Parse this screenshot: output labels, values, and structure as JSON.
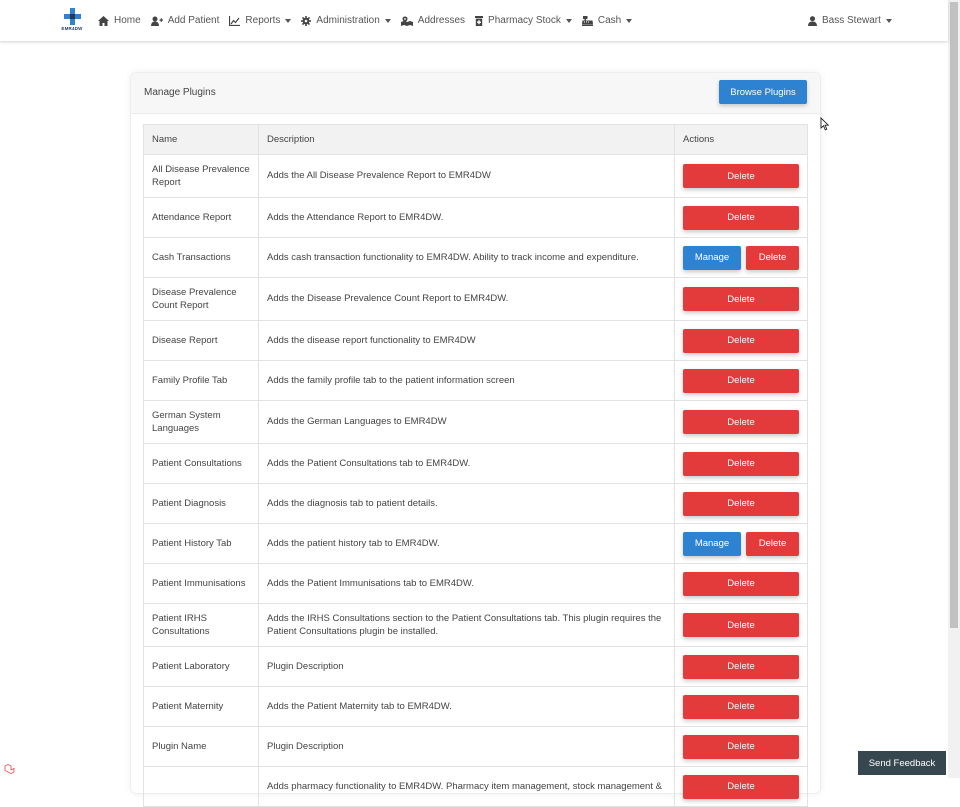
{
  "brand": {
    "name": "EMR4DW",
    "accent": "#2d82d2"
  },
  "nav": {
    "items": [
      {
        "label": "Home",
        "icon": "home-icon",
        "dropdown": false
      },
      {
        "label": "Add Patient",
        "icon": "user-plus-icon",
        "dropdown": false
      },
      {
        "label": "Reports",
        "icon": "chart-icon",
        "dropdown": true
      },
      {
        "label": "Administration",
        "icon": "gear-icon",
        "dropdown": true
      },
      {
        "label": "Addresses",
        "icon": "map-icon",
        "dropdown": false
      },
      {
        "label": "Pharmacy Stock",
        "icon": "medicine-bottle-icon",
        "dropdown": true
      },
      {
        "label": "Cash",
        "icon": "cash-register-icon",
        "dropdown": true
      }
    ],
    "user": {
      "name": "Bass Stewart",
      "icon": "user-icon"
    }
  },
  "card": {
    "title": "Manage Plugins",
    "browse_label": "Browse Plugins"
  },
  "table": {
    "headers": [
      "Name",
      "Description",
      "Actions"
    ],
    "rows": [
      {
        "name": "All Disease Prevalence Report",
        "description": "Adds the All Disease Prevalence Report to EMR4DW",
        "manage": false
      },
      {
        "name": "Attendance Report",
        "description": "Adds the Attendance Report to EMR4DW.",
        "manage": false
      },
      {
        "name": "Cash Transactions",
        "description": "Adds cash transaction functionality to EMR4DW. Ability to track income and expenditure.",
        "manage": true
      },
      {
        "name": "Disease Prevalence Count Report",
        "description": "Adds the Disease Prevalence Count Report to EMR4DW.",
        "manage": false
      },
      {
        "name": "Disease Report",
        "description": "Adds the disease report functionality to EMR4DW",
        "manage": false
      },
      {
        "name": "Family Profile Tab",
        "description": "Adds the family profile tab to the patient information screen",
        "manage": false
      },
      {
        "name": "German System Languages",
        "description": "Adds the German Languages to EMR4DW",
        "manage": false
      },
      {
        "name": "Patient Consultations",
        "description": "Adds the Patient Consultations tab to EMR4DW.",
        "manage": false
      },
      {
        "name": "Patient Diagnosis",
        "description": "Adds the diagnosis tab to patient details.",
        "manage": false
      },
      {
        "name": "Patient History Tab",
        "description": "Adds the patient history tab to EMR4DW.",
        "manage": true
      },
      {
        "name": "Patient Immunisations",
        "description": "Adds the Patient Immunisations tab to EMR4DW.",
        "manage": false
      },
      {
        "name": "Patient IRHS Consultations",
        "description": "Adds the IRHS Consultations section to the Patient Consultations tab. This plugin requires the Patient Consultations plugin be installed.",
        "manage": false
      },
      {
        "name": "Patient Laboratory",
        "description": "Plugin Description",
        "manage": false
      },
      {
        "name": "Patient Maternity",
        "description": "Adds the Patient Maternity tab to EMR4DW.",
        "manage": false
      },
      {
        "name": "Plugin Name",
        "description": "Plugin Description",
        "manage": false
      },
      {
        "name": "",
        "description": "Adds pharmacy functionality to EMR4DW. Pharmacy item management, stock management &",
        "manage": false
      }
    ],
    "manage_label": "Manage",
    "delete_label": "Delete"
  },
  "feedback_label": "Send Feedback",
  "colors": {
    "danger": "#e33b3b",
    "primary": "#2d82d2",
    "feedback": "#37474f"
  }
}
